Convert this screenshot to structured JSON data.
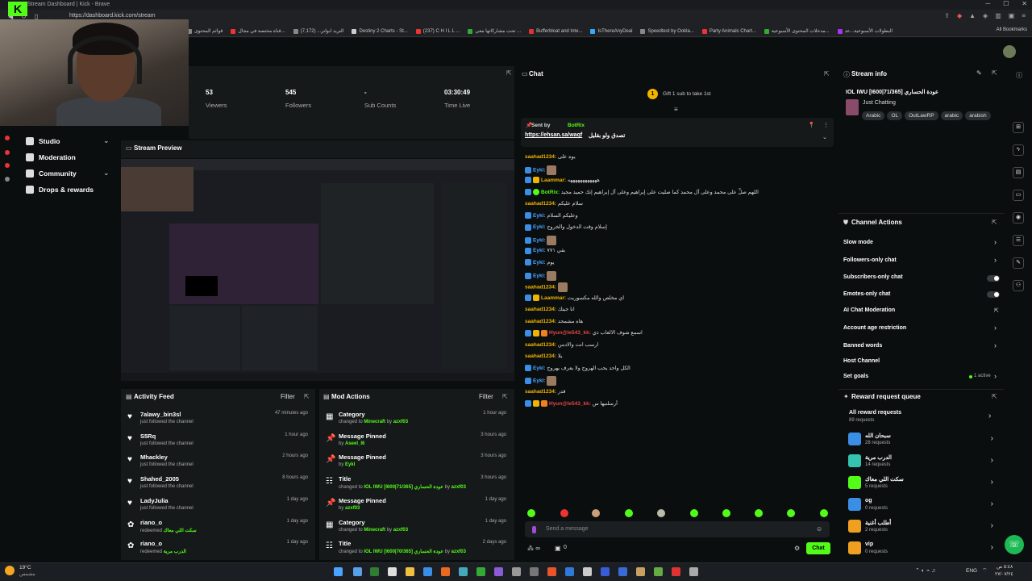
{
  "browser": {
    "title": "Stream Dashboard | Kick - Brave",
    "url": "https://dashboard.kick.com/stream",
    "bookmarks": [
      "قوائم المحتوى",
      "قناة مختصة في مجال...",
      "التريد ابواتر... (7,172)",
      "Destiny 2 Charts - St...",
      "(237) C H I L L ...",
      "تحت مشاركاتها معي ...",
      "Bufferbloat and Inte...",
      "IsThereAnyDeal",
      "Speedtest by Ookla...",
      "Party Animals Chart...",
      "مدخلات المحتوى الأسبوعية...",
      "البطولات الأسبوعية...عد"
    ],
    "all_bookmarks": "All Bookmarks"
  },
  "sidebar": {
    "items": [
      {
        "label": "Studio"
      },
      {
        "label": "Moderation"
      },
      {
        "label": "Community"
      },
      {
        "label": "Drops & rewards"
      }
    ]
  },
  "stats": [
    {
      "value": "53",
      "label": "Viewers"
    },
    {
      "value": "545",
      "label": "Followers"
    },
    {
      "value": "-",
      "label": "Sub Counts"
    },
    {
      "value": "03:30:49",
      "label": "Time Live"
    }
  ],
  "preview": {
    "title": "Stream Preview"
  },
  "activity": {
    "title": "Activity Feed",
    "filter": "Filter",
    "rows": [
      {
        "name": "7alawy_bin3sl",
        "sub": "just followed the channel",
        "time": "47 minutes ago"
      },
      {
        "name": "S5Rq",
        "sub": "just followed the channel",
        "time": "1 hour ago"
      },
      {
        "name": "Mhackley",
        "sub": "just followed the channel",
        "time": "2 hours ago"
      },
      {
        "name": "Shahed_2005",
        "sub": "just followed the channel",
        "time": "8 hours ago"
      },
      {
        "name": "LadyJulia",
        "sub": "just followed the channel",
        "time": "1 day ago"
      },
      {
        "name": "riano_o",
        "sub": "redeemed",
        "extra": "سكت اللي معاك",
        "time": "1 day ago"
      },
      {
        "name": "riano_o",
        "sub": "redeemed",
        "extra": "الدرب مرية",
        "time": "1 day ago"
      }
    ]
  },
  "mod": {
    "title": "Mod Actions",
    "filter": "Filter",
    "rows": [
      {
        "name": "Category",
        "pre": "changed to ",
        "hl": "Minecraft",
        "by": " by ",
        "user": "azxf03",
        "time": "1 hour ago"
      },
      {
        "name": "Message Pinned",
        "pre": "by ",
        "hl": "Aseel_I6",
        "by": "",
        "user": "",
        "time": "3 hours ago"
      },
      {
        "name": "Message Pinned",
        "pre": "by ",
        "hl": "Eykl",
        "by": "",
        "user": "",
        "time": "3 hours ago"
      },
      {
        "name": "Title",
        "pre": "changed to ",
        "hl": "IOL IWU [I600|71/365] عودة الحساري",
        "by": " by ",
        "user": "azxf03",
        "time": "3 hours ago"
      },
      {
        "name": "Message Pinned",
        "pre": "by ",
        "hl": "azxf03",
        "by": "",
        "user": "",
        "time": "1 day ago"
      },
      {
        "name": "Category",
        "pre": "changed to ",
        "hl": "Minecraft",
        "by": " by ",
        "user": "azxf03",
        "time": "1 day ago"
      },
      {
        "name": "Title",
        "pre": "changed to ",
        "hl": "IOL IWU [I600|70/365] عودة الحساري",
        "by": " by ",
        "user": "azxf03",
        "time": "2 days ago"
      }
    ]
  },
  "chat": {
    "title": "Chat",
    "gift": "Gift 1 sub to take 1st",
    "pinned_by_label": "Sent by",
    "pinned_by": "BotRix",
    "pinned_link": "https://ehsan.sa/waqf",
    "pinned_text": "تصدق ولو بقليل",
    "messages": [
      {
        "user": "saahad1234:",
        "color": "#f0b400",
        "text": "يوه على"
      },
      {
        "user": "Eykl:",
        "color": "#4aa3ff",
        "text": ""
      },
      {
        "user": "Laammar:",
        "color": "#f0b400",
        "text": "ههههههههههههه"
      },
      {
        "user": "BotRix:",
        "color": "#53fc18",
        "text": "اللهم صلِّ على محمد وعلى آل محمد كما صليت على إبراهيم وعلى آل إبراهيم إنك حميد مجيد"
      },
      {
        "user": "saahad1234:",
        "color": "#f0b400",
        "text": "سلام عليكم"
      },
      {
        "user": "Eykl:",
        "color": "#4aa3ff",
        "text": "وعليكم السلام"
      },
      {
        "user": "Eykl:",
        "color": "#4aa3ff",
        "text": "إسلام وقت الدخول والخروج"
      },
      {
        "user": "Eykl:",
        "color": "#4aa3ff",
        "text": ""
      },
      {
        "user": "Eykl:",
        "color": "#4aa3ff",
        "text": "بقي ٧٧١"
      },
      {
        "user": "Eykl:",
        "color": "#4aa3ff",
        "text": "يوم"
      },
      {
        "user": "Eykl:",
        "color": "#4aa3ff",
        "text": ""
      },
      {
        "user": "saahad1234:",
        "color": "#f0b400",
        "text": ""
      },
      {
        "user": "Laammar:",
        "color": "#f0b400",
        "text": "اي مخلص والله مكسوريت"
      },
      {
        "user": "saahad1234:",
        "color": "#f0b400",
        "text": "انا جيتك"
      },
      {
        "user": "saahad1234:",
        "color": "#f0b400",
        "text": "هاه مشمحد"
      },
      {
        "user": "Hyun@le543_kk:",
        "color": "#e84545",
        "text": "اسمع شوف الالعاب ذي"
      },
      {
        "user": "saahad1234:",
        "color": "#f0b400",
        "text": "ارسب انت والادمن"
      },
      {
        "user": "saahad1234:",
        "color": "#f0b400",
        "text": "يلا"
      },
      {
        "user": "Eykl:",
        "color": "#4aa3ff",
        "text": "الكل واحد يحب الهروج ولا يعرف يهروج"
      },
      {
        "user": "Eykl:",
        "color": "#4aa3ff",
        "text": ""
      },
      {
        "user": "saahad1234:",
        "color": "#f0b400",
        "text": "قدر"
      },
      {
        "user": "Hyun@le543_kk:",
        "color": "#e84545",
        "text": "أرسلنيها س"
      }
    ],
    "input_placeholder": "Send a message",
    "count": "0",
    "send": "Chat"
  },
  "stream_info": {
    "title": "Stream info",
    "stream_title": "IOL IWU [I600|71/365] عودة الحساري",
    "category": "Just Chatting",
    "tags": [
      "Arabic",
      "OL",
      "OutLawRP",
      "arabic",
      "arabish"
    ]
  },
  "channel_actions": {
    "title": "Channel Actions",
    "items": [
      {
        "label": "Slow mode"
      },
      {
        "label": "Followers-only chat"
      },
      {
        "label": "Subscribers-only chat"
      },
      {
        "label": "Emotes-only chat"
      },
      {
        "label": "AI Chat Moderation"
      },
      {
        "label": "Account age restriction"
      },
      {
        "label": "Banned words"
      },
      {
        "label": "Host Channel"
      },
      {
        "label": "Set goals"
      }
    ],
    "goals_status": "1 active"
  },
  "rewards": {
    "title": "Reward request queue",
    "all_label": "All reward requests",
    "all_count": "89 requests",
    "items": [
      {
        "name": "سبحان الله",
        "count": "28 requests",
        "color": "#3a8ee6"
      },
      {
        "name": "الدرب مرية",
        "count": "14 requests",
        "color": "#35c2b0"
      },
      {
        "name": "سكت اللي معاك",
        "count": "5 requests",
        "color": "#53fc18"
      },
      {
        "name": "og",
        "count": "0 requests",
        "color": "#3a8ee6"
      },
      {
        "name": "أطلب أغنية",
        "count": "2 requests",
        "color": "#f0a020"
      },
      {
        "name": "vip",
        "count": "0 requests",
        "color": "#f0a020"
      }
    ]
  },
  "taskbar": {
    "weather": "19°C",
    "weather_sub": "مشمس",
    "lang": "ENG",
    "time": "٥:٤٨ ص",
    "date": "٢٧/٠٧/٢٤"
  }
}
